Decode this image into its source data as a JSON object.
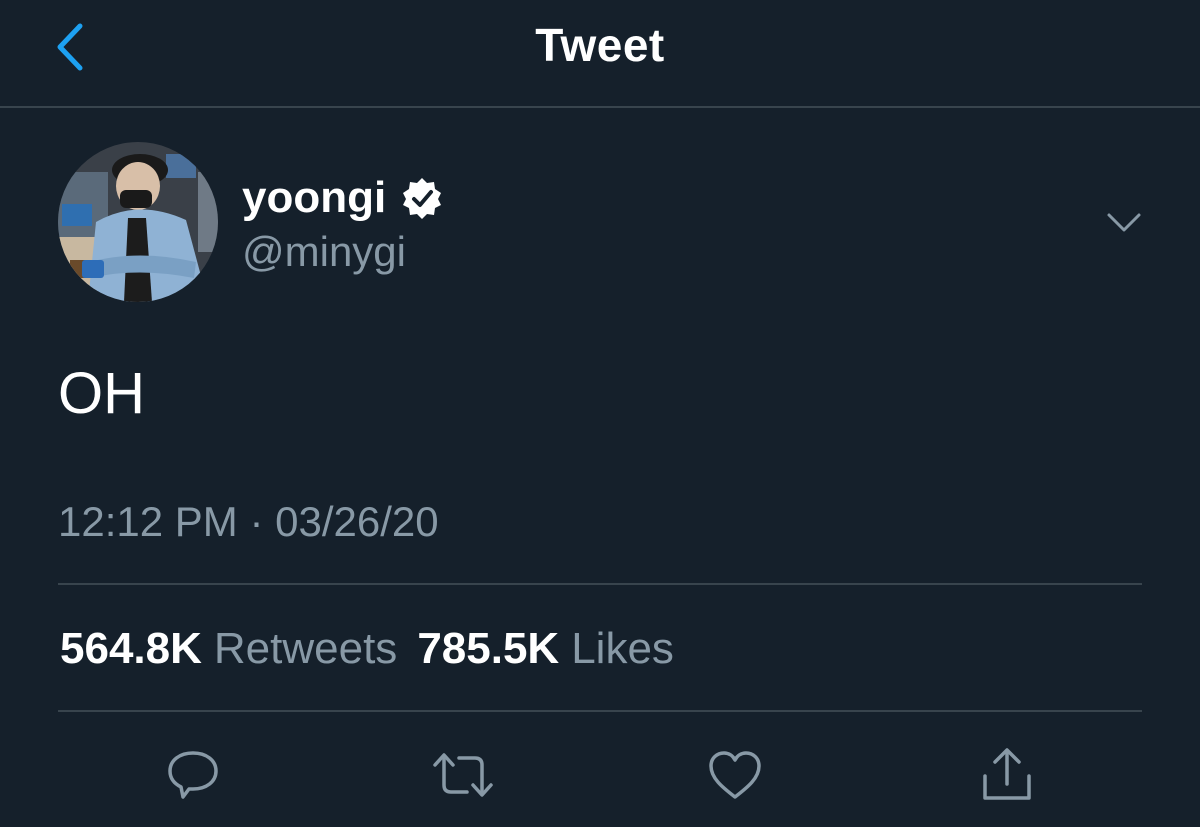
{
  "nav": {
    "title": "Tweet",
    "back_icon": "chevron-left-icon"
  },
  "author": {
    "display_name": "yoongi",
    "handle": "@minygi",
    "verified": true,
    "verified_icon": "verified-badge-icon"
  },
  "tweet": {
    "text": "OH",
    "timestamp": "12:12 PM · 03/26/20"
  },
  "stats": {
    "retweets_count": "564.8K",
    "retweets_label": "Retweets",
    "likes_count": "785.5K",
    "likes_label": "Likes"
  },
  "actions": [
    {
      "name": "reply",
      "icon": "reply-icon"
    },
    {
      "name": "retweet",
      "icon": "retweet-icon"
    },
    {
      "name": "like",
      "icon": "heart-icon"
    },
    {
      "name": "share",
      "icon": "share-icon"
    }
  ],
  "colors": {
    "background": "#15202b",
    "accent": "#1da1f2",
    "secondary_text": "#8899a6",
    "divider": "#38444d",
    "primary_text": "#ffffff"
  }
}
